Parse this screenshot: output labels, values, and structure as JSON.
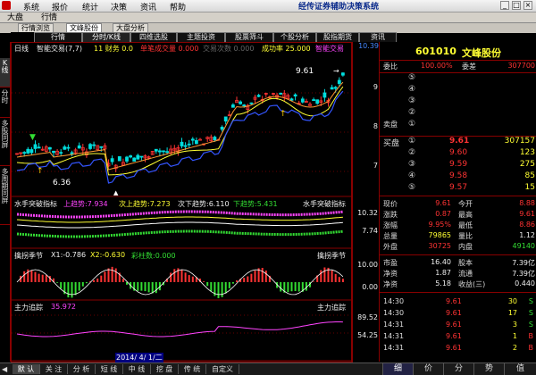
{
  "app_title": "经传证券辅助决策系统",
  "menu": [
    "系统",
    "报价",
    "统计",
    "决策",
    "资讯",
    "帮助"
  ],
  "nav_tabs": [
    "大盘",
    "行情",
    "",
    "",
    "",
    "",
    "",
    "",
    "",
    "",
    ""
  ],
  "subnav": [
    "行情浏览",
    "文峰股份",
    "大盘分析"
  ],
  "chart_tabs": [
    "行情",
    "分时/K线",
    "四维选股",
    "主题投资",
    "股票筛斗",
    "个股分析",
    "股指期货",
    "资讯"
  ],
  "side_tabs": [
    "K线",
    "分时",
    "多股同屏",
    "多周期同屏"
  ],
  "kline": {
    "period": "日线",
    "indicator": "智能交易(7,7)",
    "legend": [
      {
        "t": "11 财务 0.0",
        "c": "#ffff33"
      },
      {
        "t": "单笔成交量 0.000",
        "c": "#ff3333"
      },
      {
        "t": "交易次数 0.000",
        "c": "#666666"
      },
      {
        "t": "成功率 25.000",
        "c": "#ffff33"
      },
      {
        "t": "智能交易",
        "c": "#ff44ff"
      },
      {
        "t": "10.39",
        "c": "#4488ff"
      }
    ],
    "high_label": "9.61",
    "low_label": "6.36",
    "axis": [
      "9",
      "8",
      "7"
    ]
  },
  "indicator2": {
    "name": "水手突破指标",
    "items": [
      {
        "t": "上趋势:7.934",
        "c": "#ff44ff"
      },
      {
        "t": "次上趋势:7.273",
        "c": "#ffff33"
      },
      {
        "t": "次下趋势:6.110",
        "c": "#eeeeee"
      },
      {
        "t": "下趋势:5.431",
        "c": "#33dd33"
      }
    ],
    "right_title": "水手突破指标",
    "axis": [
      "10.32",
      "7.74"
    ]
  },
  "indicator3": {
    "name": "擒拐季节",
    "items": [
      {
        "t": "X1:-0.786",
        "c": "#eeeeee"
      },
      {
        "t": "X2:-0.630",
        "c": "#ffff33"
      },
      {
        "t": "彩柱数:0.000",
        "c": "#33dd33"
      }
    ],
    "right_title": "擒拐季节",
    "axis": [
      "10.00",
      "0.00"
    ]
  },
  "indicator4": {
    "name": "主力追踪",
    "value": "35.972",
    "right_title": "主力追踪",
    "axis": [
      "89.52",
      "54.25"
    ],
    "date": "2014/ 4/ 1/二"
  },
  "stock": {
    "code": "601010",
    "name": "文峰股份"
  },
  "order_ratio": {
    "label": "委比",
    "value": "100.00%",
    "diff_label": "委差",
    "diff": "307700"
  },
  "sell_levels": [
    "⑤",
    "④",
    "③",
    "②",
    "①"
  ],
  "sell_label": "卖盘",
  "buy_label": "买盘",
  "buy_levels": [
    {
      "price": "9.61",
      "vol": "307157"
    },
    {
      "price": "9.60",
      "vol": "123"
    },
    {
      "price": "9.59",
      "vol": "275"
    },
    {
      "price": "9.58",
      "vol": "85"
    },
    {
      "price": "9.57",
      "vol": "15"
    }
  ],
  "quote": [
    {
      "k1": "现价",
      "v1": "9.61",
      "c1": "#ff3333",
      "k2": "今开",
      "v2": "8.88",
      "c2": "#ff3333"
    },
    {
      "k1": "涨跌",
      "v1": "0.87",
      "c1": "#ff3333",
      "k2": "最高",
      "v2": "9.61",
      "c2": "#ff3333"
    },
    {
      "k1": "涨幅",
      "v1": "9.95%",
      "c1": "#ff3333",
      "k2": "最低",
      "v2": "8.86",
      "c2": "#ff3333"
    },
    {
      "k1": "总量",
      "v1": "79865",
      "c1": "#ffff33",
      "k2": "量比",
      "v2": "1.12",
      "c2": "#eeeeee"
    },
    {
      "k1": "外盘",
      "v1": "30725",
      "c1": "#ff3333",
      "k2": "内盘",
      "v2": "49140",
      "c2": "#33dd33"
    }
  ],
  "fundamentals": [
    {
      "k1": "市盈",
      "v1": "16.40",
      "k2": "股本",
      "v2": "7.39亿"
    },
    {
      "k1": "净资",
      "v1": "1.87",
      "k2": "流通",
      "v2": "7.39亿"
    },
    {
      "k1": "净资",
      "v1": "5.18",
      "k2": "收益(三)",
      "v2": "0.440"
    }
  ],
  "trades": [
    {
      "time": "14:30",
      "price": "9.61",
      "vol": "30",
      "dir": "S"
    },
    {
      "time": "14:30",
      "price": "9.61",
      "vol": "17",
      "dir": "S"
    },
    {
      "time": "14:31",
      "price": "9.61",
      "vol": "3",
      "dir": "S"
    },
    {
      "time": "14:31",
      "price": "9.61",
      "vol": "1",
      "dir": "B"
    },
    {
      "time": "14:31",
      "price": "9.61",
      "vol": "2",
      "dir": "B"
    }
  ],
  "bottom_tabs": [
    "默 认",
    "关 注",
    "分 析",
    "短 线",
    "中 线",
    "挖 盘",
    "传 统",
    "自定义"
  ],
  "right_bottom_tabs": [
    "细",
    "价",
    "分",
    "势",
    "值"
  ],
  "colors": {
    "up": "#ff3333",
    "down": "#33dd33",
    "bg": "#000000",
    "frame": "#880000"
  }
}
